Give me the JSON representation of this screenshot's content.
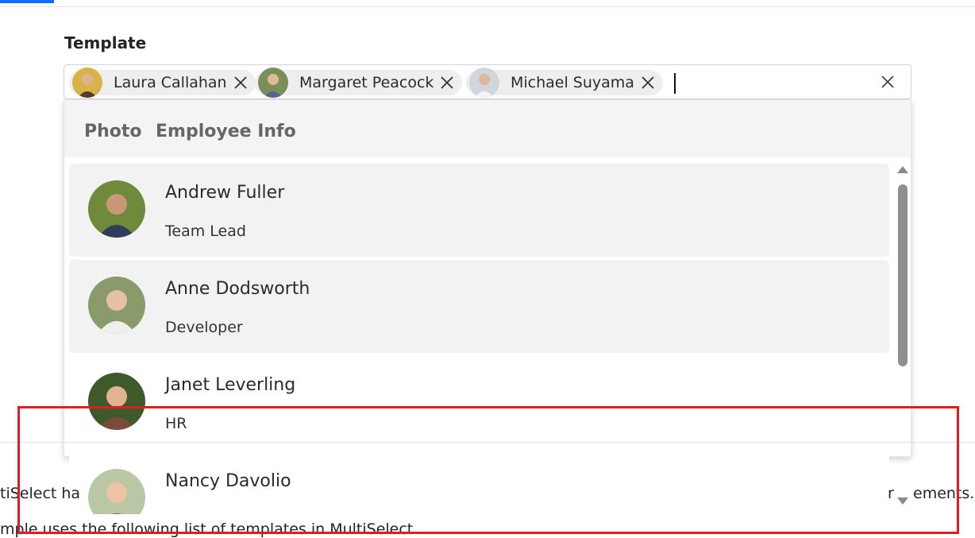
{
  "field": {
    "label": "Template"
  },
  "selected_chips": [
    {
      "name": "Laura Callahan"
    },
    {
      "name": "Margaret Peacock"
    },
    {
      "name": "Michael Suyama"
    }
  ],
  "popup": {
    "header": {
      "photo": "Photo",
      "info": "Employee Info"
    },
    "items": [
      {
        "name": "Andrew Fuller",
        "title": "Team Lead"
      },
      {
        "name": "Anne Dodsworth",
        "title": "Developer"
      },
      {
        "name": "Janet Leverling",
        "title": "HR"
      },
      {
        "name": "Nancy Davolio",
        "title": ""
      }
    ]
  },
  "description": {
    "line1_start": "tiSelect ha",
    "line1_end": "r",
    "line1_end2": "ements.",
    "line2": "mple uses the following list of templates in MultiSelect."
  },
  "icons": {
    "chip_remove": "close-icon",
    "clear_all": "close-icon",
    "scroll_up": "arrow-up-icon",
    "scroll_down": "arrow-down-icon"
  },
  "colors": {
    "accent": "#0d6efd",
    "highlight": "#e31b23"
  }
}
